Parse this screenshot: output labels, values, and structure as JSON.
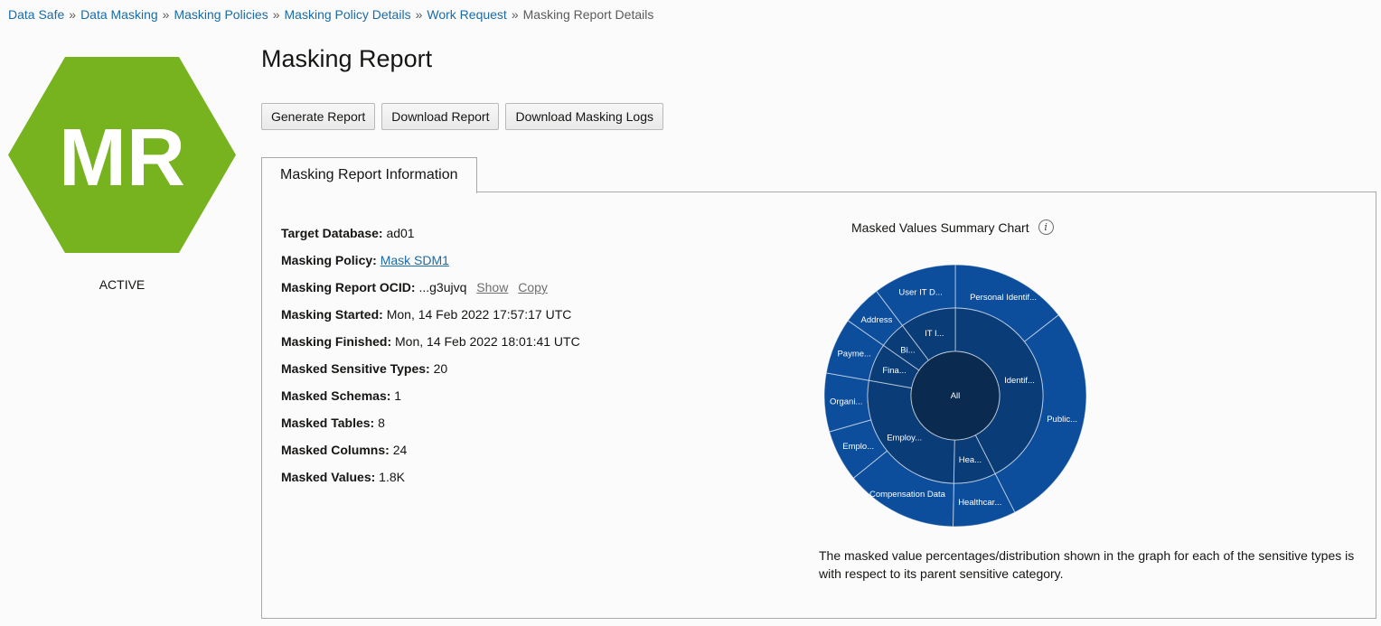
{
  "breadcrumb": {
    "items": [
      "Data Safe",
      "Data Masking",
      "Masking Policies",
      "Masking Policy Details",
      "Work Request"
    ],
    "current": "Masking Report Details",
    "separator": "»"
  },
  "badge": {
    "initials": "MR",
    "color": "#76b31f",
    "status": "ACTIVE"
  },
  "page_title": "Masking Report",
  "actions": {
    "generate": "Generate Report",
    "download": "Download Report",
    "download_logs": "Download Masking Logs"
  },
  "tab": {
    "label": "Masking Report Information"
  },
  "info": {
    "target_database": {
      "label": "Target Database:",
      "value": "ad01"
    },
    "masking_policy": {
      "label": "Masking Policy:",
      "value": "Mask SDM1"
    },
    "ocid": {
      "label": "Masking Report OCID:",
      "value": "...g3ujvq",
      "show": "Show",
      "copy": "Copy"
    },
    "started": {
      "label": "Masking Started:",
      "value": "Mon, 14 Feb 2022 17:57:17 UTC"
    },
    "finished": {
      "label": "Masking Finished:",
      "value": "Mon, 14 Feb 2022 18:01:41 UTC"
    },
    "sensitive_types": {
      "label": "Masked Sensitive Types:",
      "value": "20"
    },
    "schemas": {
      "label": "Masked Schemas:",
      "value": "1"
    },
    "tables": {
      "label": "Masked Tables:",
      "value": "8"
    },
    "columns": {
      "label": "Masked Columns:",
      "value": "24"
    },
    "values": {
      "label": "Masked Values:",
      "value": "1.8K"
    }
  },
  "chart": {
    "title": "Masked Values Summary Chart",
    "info_icon": "info-icon",
    "colors": {
      "center": "#0b2a4f",
      "inner": "#0a3d78",
      "outer": "#0d4e9c",
      "divider": "#ffffff"
    },
    "center_label": "All",
    "note": "The masked value percentages/distribution shown in the graph for each of the sensitive types is with respect to its parent sensitive category."
  },
  "chart_data": {
    "type": "sunburst",
    "center": "All",
    "inner_ring": [
      {
        "label": "Identif...",
        "share_deg": 153
      },
      {
        "label": "Hea...",
        "share_deg": 28
      },
      {
        "label": "Employ...",
        "share_deg": 99
      },
      {
        "label": "Fina...",
        "share_deg": 25
      },
      {
        "label": "Bi...",
        "share_deg": 18
      },
      {
        "label": "IT I...",
        "share_deg": 37
      }
    ],
    "outer_ring": [
      {
        "label": "Personal Identif...",
        "share_deg": 52
      },
      {
        "label": "Public...",
        "share_deg": 101
      },
      {
        "label": "Healthcar...",
        "share_deg": 28
      },
      {
        "label": "Compensation Data",
        "share_deg": 50
      },
      {
        "label": "Emplo...",
        "share_deg": 23
      },
      {
        "label": "Organi...",
        "share_deg": 26
      },
      {
        "label": "Payme...",
        "share_deg": 25
      },
      {
        "label": "Address",
        "share_deg": 18
      },
      {
        "label": "User IT D...",
        "share_deg": 37
      }
    ]
  }
}
